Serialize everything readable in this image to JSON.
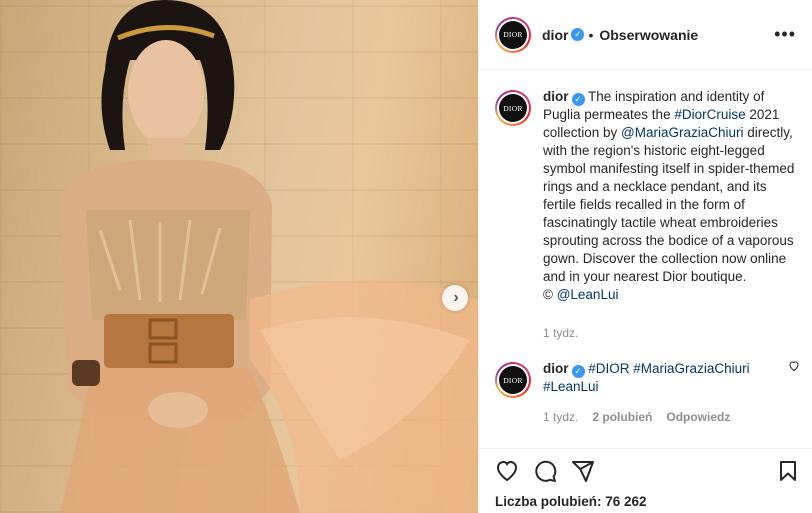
{
  "media": {
    "next_button": "next-arrow"
  },
  "header": {
    "username": "dior",
    "avatar_text": "DIOR",
    "separator": "•",
    "follow_label": "Obserwowanie",
    "more_label": "•••"
  },
  "caption": {
    "username": "dior",
    "avatar_text": "DIOR",
    "text_1": "The inspiration and identity of Puglia permeates the ",
    "tag_1": "#DiorCruise",
    "text_2": " 2021 collection by ",
    "tag_2": "@MariaGraziaChiuri",
    "text_3": " directly, with the region's historic eight-legged symbol manifesting itself in spider-themed rings and a necklace pendant, and its fertile fields recalled in the form of fascinatingly tactile wheat embroideries sprouting across the bodice of a vaporous gown. Discover the collection now online and in your nearest Dior boutique.",
    "credit_prefix": "© ",
    "credit_tag": "@LeanLui",
    "time": "1 tydz."
  },
  "comment": {
    "username": "dior",
    "avatar_text": "DIOR",
    "tags": [
      "#DIOR",
      "#MariaGraziaChiuri",
      "#LeanLui"
    ],
    "time": "1 tydz.",
    "likes": "2 polubień",
    "reply_label": "Odpowiedz"
  },
  "actions": {
    "icons": [
      "heart-icon",
      "comment-icon",
      "share-icon",
      "bookmark-icon"
    ],
    "likes_text": "Liczba polubień: 76 262"
  },
  "colors": {
    "link": "#00376b",
    "verified": "#3897f0",
    "muted": "#8e8e8e"
  }
}
